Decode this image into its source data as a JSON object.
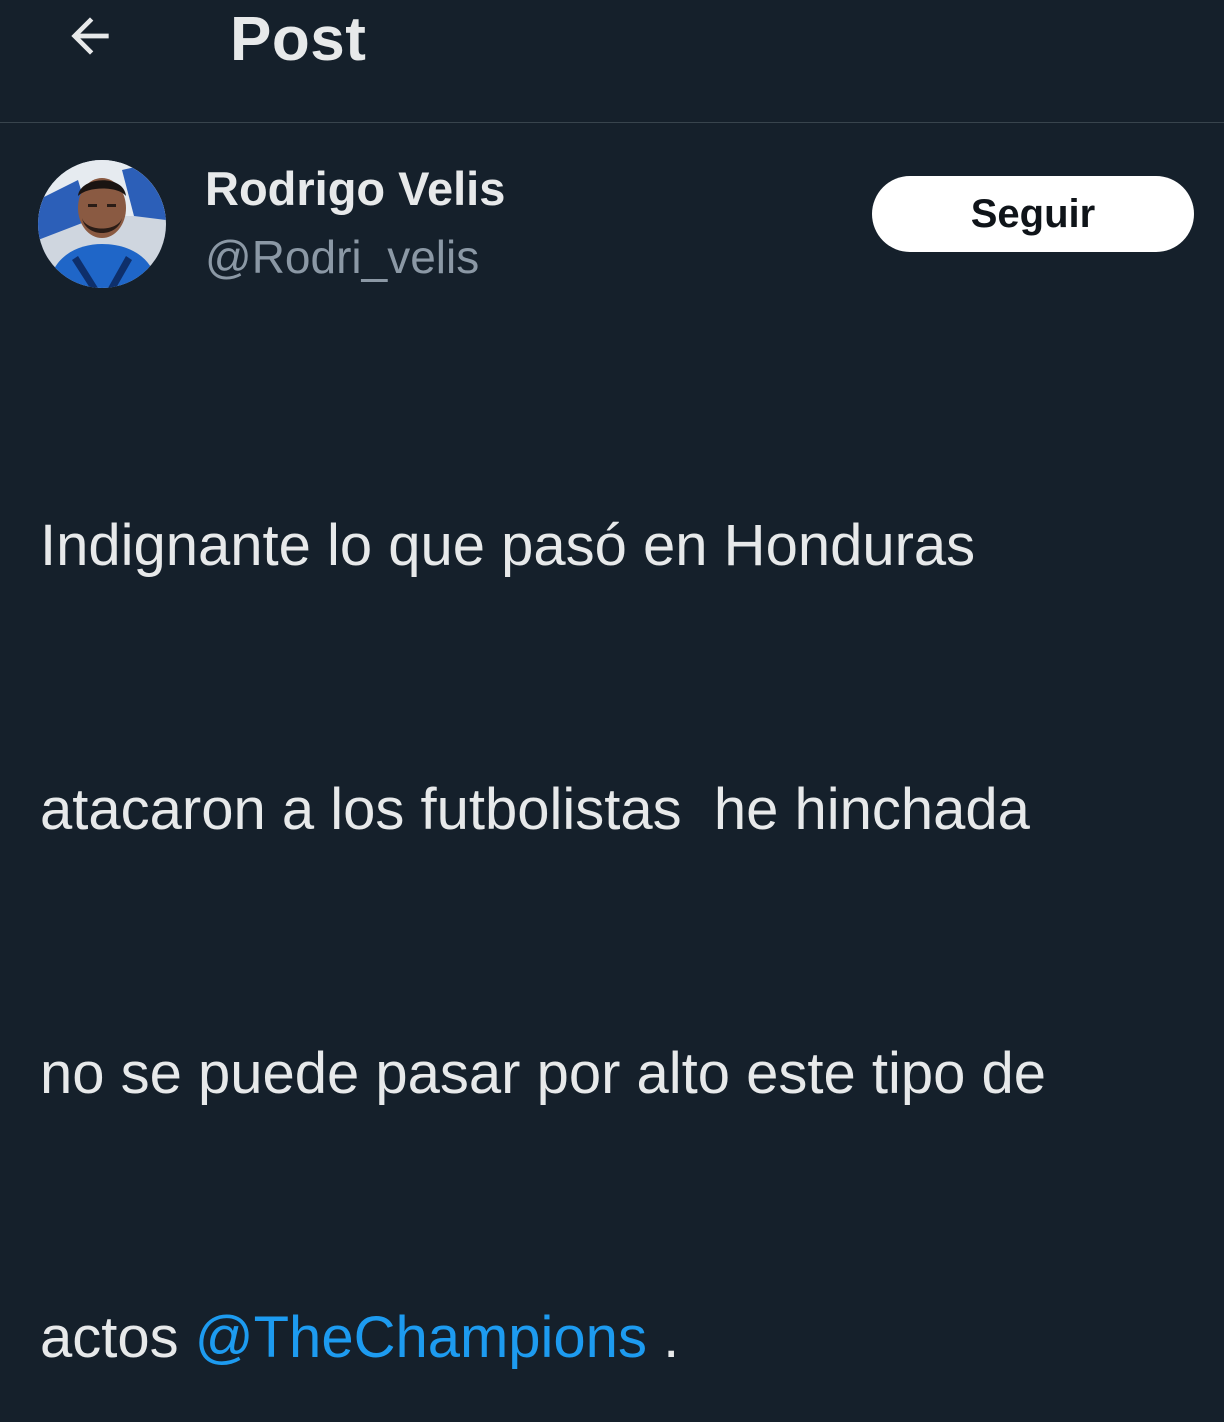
{
  "header": {
    "back_icon": "arrow-left-icon",
    "title": "Post"
  },
  "author": {
    "name": "Rodrigo Velis",
    "handle": "@Rodri_velis",
    "avatar_icon": "profile-photo"
  },
  "follow_button": {
    "label": "Seguir"
  },
  "post": {
    "lines": [
      "Indignante lo que pasó en Honduras",
      "atacaron a los futbolistas  he hinchada",
      "no se puede pasar por alto este tipo de",
      "actos "
    ],
    "mention": "@TheChampions",
    "trailing": " ."
  },
  "colors": {
    "background": "#15202b",
    "text": "#e7e9ea",
    "muted": "#8b98a5",
    "link": "#1d9bf0",
    "divider": "#38444d",
    "button_bg": "#ffffff"
  }
}
